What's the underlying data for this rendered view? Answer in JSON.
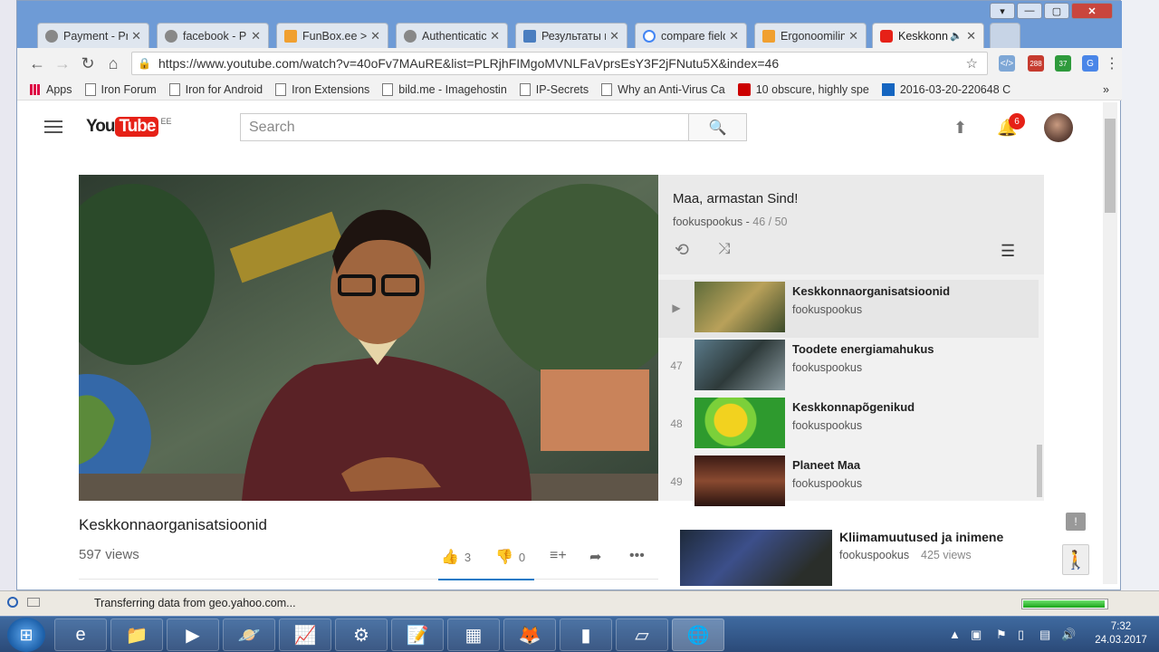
{
  "browser": {
    "tabs": [
      {
        "label": "Payment - Pr",
        "icon": "globe-icon",
        "icon_color": "#666666",
        "active": false
      },
      {
        "label": "facebook - P",
        "icon": "globe-icon",
        "icon_color": "#666666",
        "active": false
      },
      {
        "label": "FunBox.ee >",
        "icon": "funbox-icon",
        "icon_color": "#f0a030",
        "active": false
      },
      {
        "label": "Authenticatic",
        "icon": "globe-icon",
        "icon_color": "#666666",
        "active": false
      },
      {
        "label": "Результаты п",
        "icon": "doc-icon",
        "icon_color": "#4a7ec0",
        "active": false
      },
      {
        "label": "compare field",
        "icon": "google-icon",
        "icon_color": "#4285f4",
        "active": false
      },
      {
        "label": "Ergonoomilin",
        "icon": "funbox-icon",
        "icon_color": "#f0a030",
        "active": false
      },
      {
        "label": "Keskkonn",
        "icon": "youtube-icon",
        "icon_color": "#e62117",
        "active": true
      }
    ],
    "url": "https://www.youtube.com/watch?v=40oFv7MAuRE&list=PLRjhFIMgoMVNLFaVprsEsY3F2jFNutu5X&index=46",
    "ext_badges": [
      "288",
      "37"
    ],
    "bookmarks": [
      {
        "label": "Apps",
        "icon": "apps-icon"
      },
      {
        "label": "Iron Forum",
        "icon": "page-icon"
      },
      {
        "label": "Iron for Android",
        "icon": "page-icon"
      },
      {
        "label": "Iron Extensions",
        "icon": "page-icon"
      },
      {
        "label": "bild.me - Imagehostin",
        "icon": "page-icon"
      },
      {
        "label": "IP-Secrets",
        "icon": "page-icon"
      },
      {
        "label": "Why an Anti-Virus Ca",
        "icon": "page-icon"
      },
      {
        "label": "10 obscure, highly spe",
        "icon": "power-icon"
      },
      {
        "label": "2016-03-20-220648 C",
        "icon": "d-icon"
      }
    ]
  },
  "youtube": {
    "logo_you": "You",
    "logo_tube": "Tube",
    "country_code": "EE",
    "search_placeholder": "Search",
    "notification_count": "6"
  },
  "playlist": {
    "title": "Maa, armastan Sind!",
    "owner": "fookuspookus -",
    "position": "46 / 50",
    "items": [
      {
        "num": "▶",
        "title": "Keskkonnaorganisatsioonid",
        "channel": "fookuspookus"
      },
      {
        "num": "47",
        "title": "Toodete energiamahukus",
        "channel": "fookuspookus"
      },
      {
        "num": "48",
        "title": "Keskkonnapõgenikud",
        "channel": "fookuspookus"
      },
      {
        "num": "49",
        "title": "Planeet Maa",
        "channel": "fookuspookus"
      }
    ]
  },
  "video": {
    "title": "Keskkonnaorganisatsioonid",
    "views": "597 views",
    "likes": "3",
    "dislikes": "0"
  },
  "suggestion": {
    "title": "Kliimamuutused ja inimene",
    "channel": "fookuspookus",
    "views": "425 views"
  },
  "status": {
    "text": "Transferring data from geo.yahoo.com...",
    "progress": 0.98
  },
  "taskbar": {
    "time": "7:32",
    "date": "24.03.2017"
  }
}
